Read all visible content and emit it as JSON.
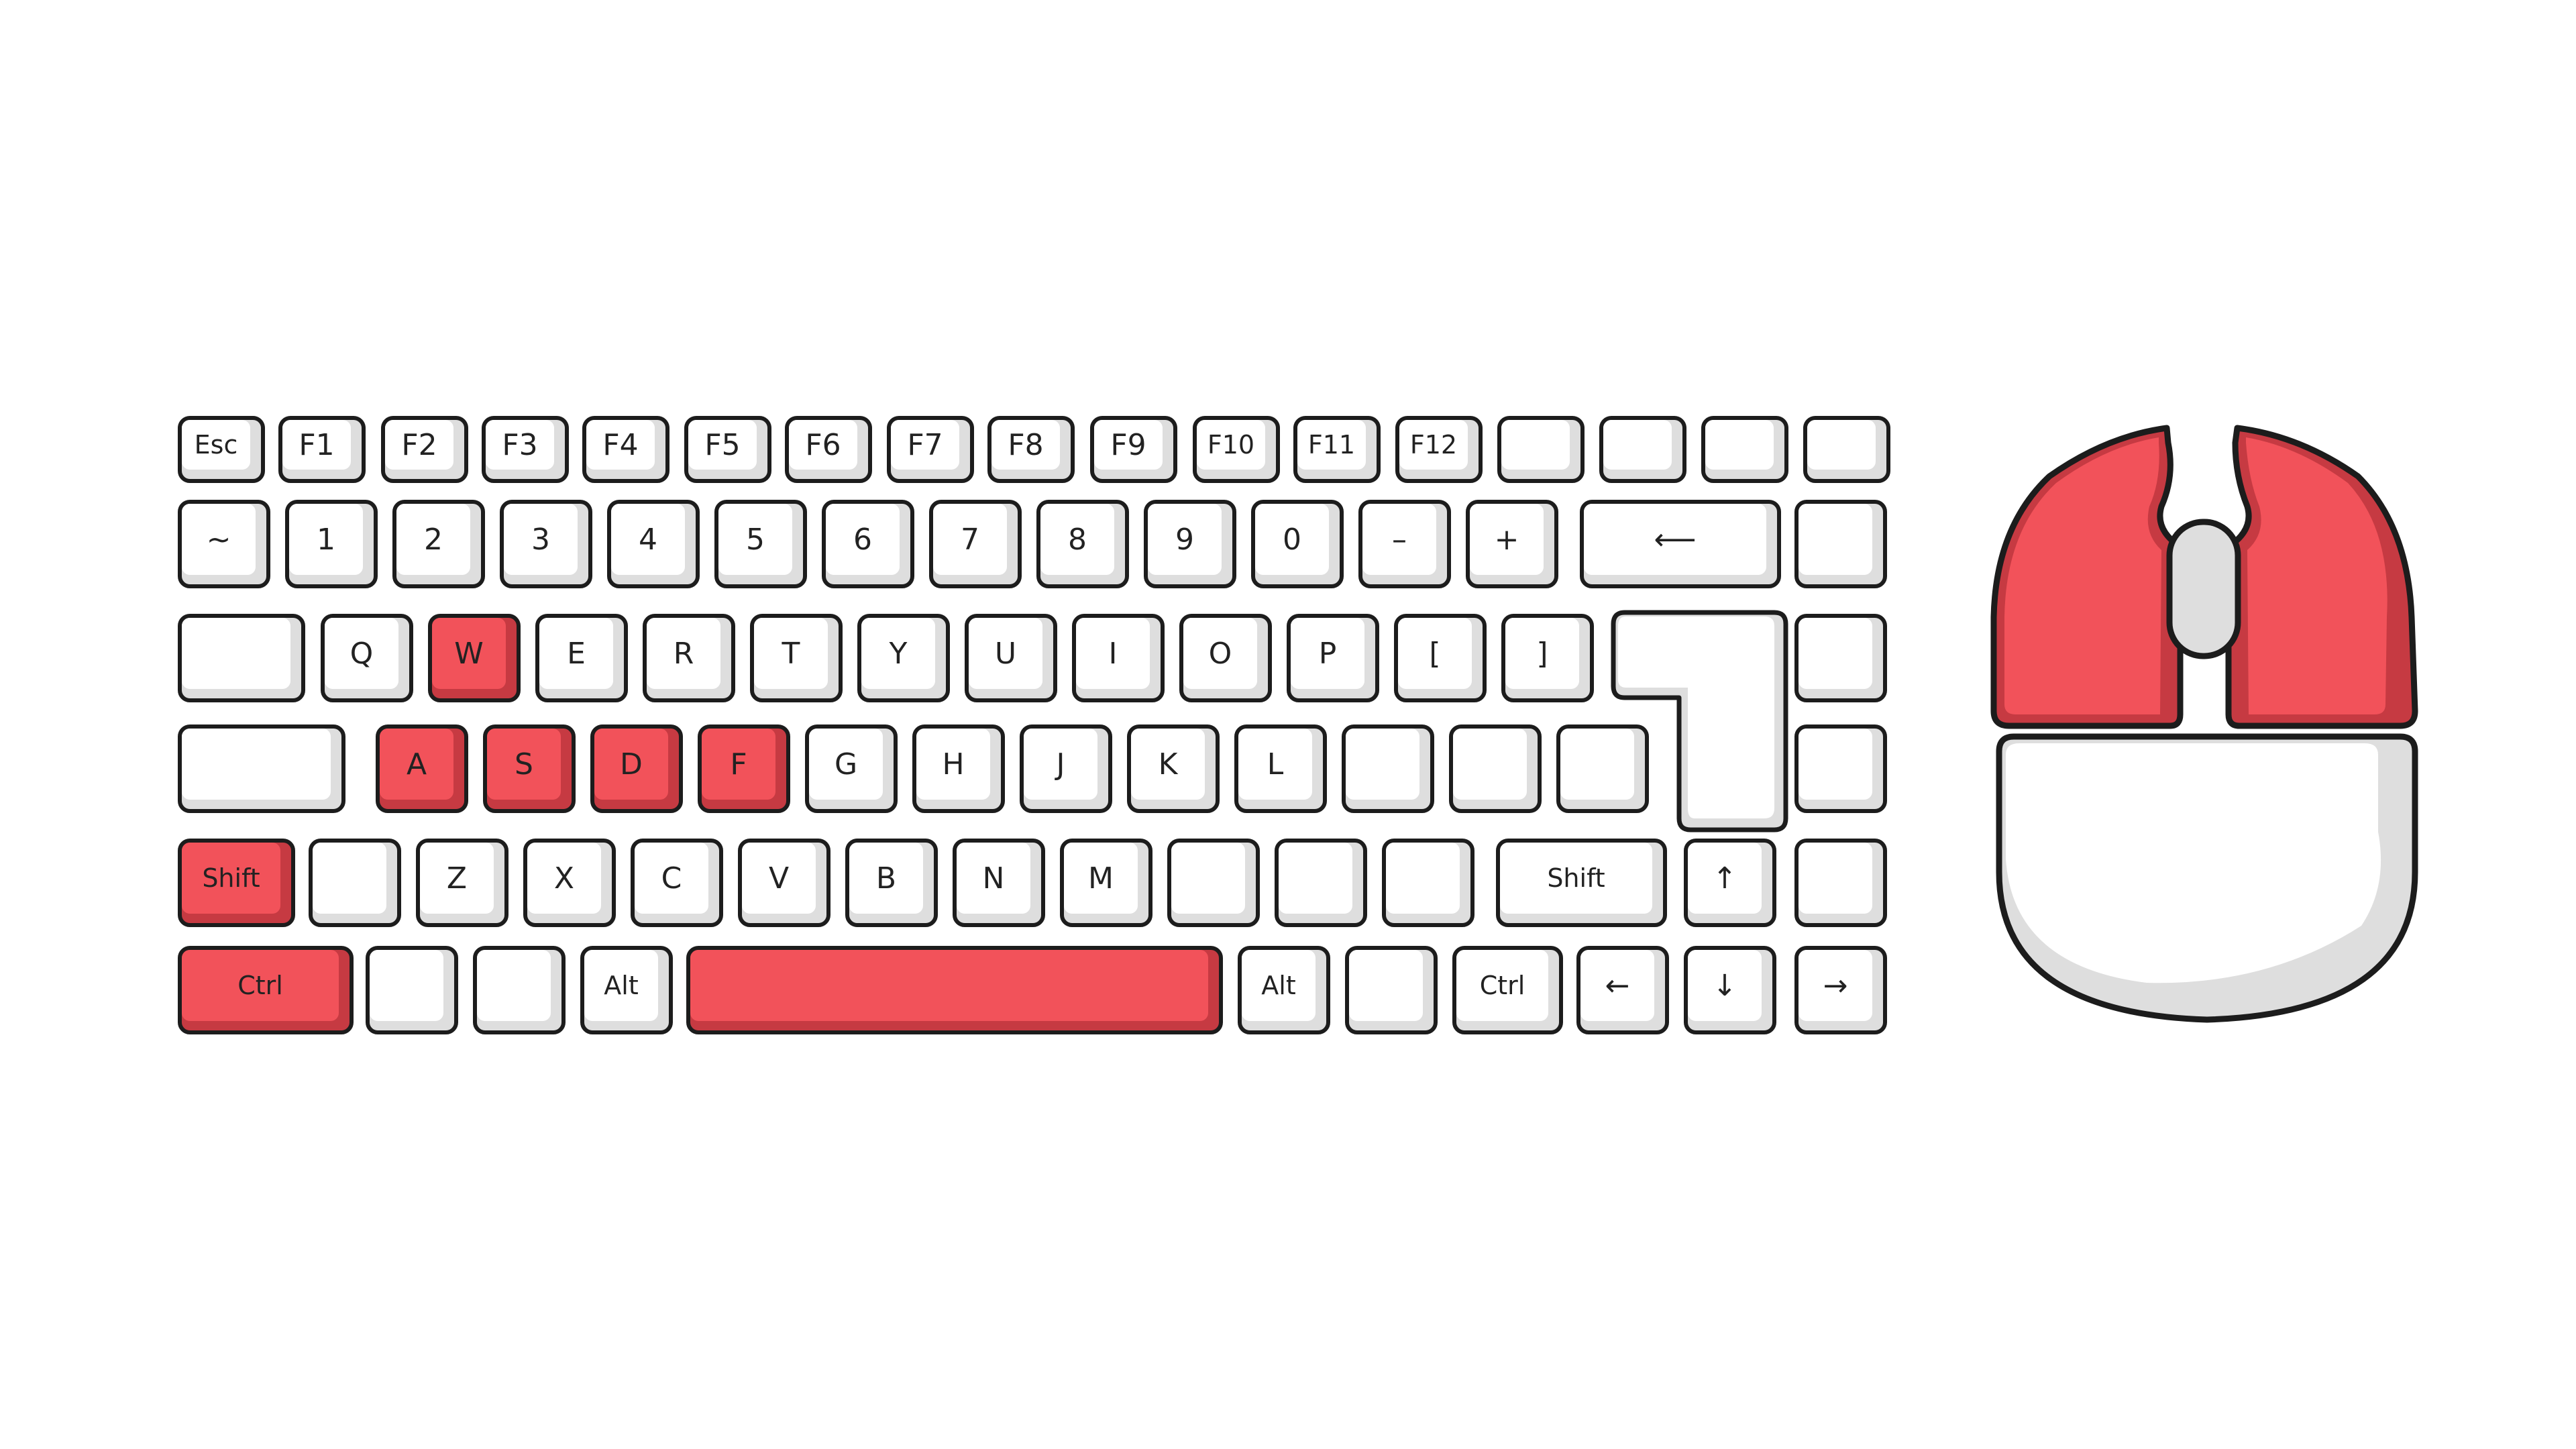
{
  "keyboard": {
    "highlight_color": "#f2525a",
    "rows": [
      [
        {
          "id": "esc",
          "label": "Esc"
        },
        {
          "id": "f1",
          "label": "F1"
        },
        {
          "id": "f2",
          "label": "F2"
        },
        {
          "id": "f3",
          "label": "F3"
        },
        {
          "id": "f4",
          "label": "F4"
        },
        {
          "id": "f5",
          "label": "F5"
        },
        {
          "id": "f6",
          "label": "F6"
        },
        {
          "id": "f7",
          "label": "F7"
        },
        {
          "id": "f8",
          "label": "F8"
        },
        {
          "id": "f9",
          "label": "F9"
        },
        {
          "id": "f10",
          "label": "F10"
        },
        {
          "id": "f11",
          "label": "F11"
        },
        {
          "id": "f12",
          "label": "F12"
        },
        {
          "id": "blank",
          "label": ""
        },
        {
          "id": "blank",
          "label": ""
        },
        {
          "id": "blank",
          "label": ""
        },
        {
          "id": "blank",
          "label": ""
        }
      ],
      [
        {
          "id": "tilde",
          "label": "~"
        },
        {
          "id": "1",
          "label": "1"
        },
        {
          "id": "2",
          "label": "2"
        },
        {
          "id": "3",
          "label": "3"
        },
        {
          "id": "4",
          "label": "4"
        },
        {
          "id": "5",
          "label": "5"
        },
        {
          "id": "6",
          "label": "6"
        },
        {
          "id": "7",
          "label": "7"
        },
        {
          "id": "8",
          "label": "8"
        },
        {
          "id": "9",
          "label": "9"
        },
        {
          "id": "0",
          "label": "0"
        },
        {
          "id": "minus",
          "label": "–"
        },
        {
          "id": "plus",
          "label": "+"
        },
        {
          "id": "backspace",
          "label": "⟵"
        },
        {
          "id": "blank",
          "label": ""
        }
      ],
      [
        {
          "id": "tab",
          "label": ""
        },
        {
          "id": "q",
          "label": "Q"
        },
        {
          "id": "w",
          "label": "W",
          "highlighted": true
        },
        {
          "id": "e",
          "label": "E"
        },
        {
          "id": "r",
          "label": "R"
        },
        {
          "id": "t",
          "label": "T"
        },
        {
          "id": "y",
          "label": "Y"
        },
        {
          "id": "u",
          "label": "U"
        },
        {
          "id": "i",
          "label": "I"
        },
        {
          "id": "o",
          "label": "O"
        },
        {
          "id": "p",
          "label": "P"
        },
        {
          "id": "lbracket",
          "label": "["
        },
        {
          "id": "rbracket",
          "label": "]"
        },
        {
          "id": "blank",
          "label": ""
        }
      ],
      [
        {
          "id": "caps",
          "label": ""
        },
        {
          "id": "a",
          "label": "A",
          "highlighted": true
        },
        {
          "id": "s",
          "label": "S",
          "highlighted": true
        },
        {
          "id": "d",
          "label": "D",
          "highlighted": true
        },
        {
          "id": "f",
          "label": "F",
          "highlighted": true
        },
        {
          "id": "g",
          "label": "G"
        },
        {
          "id": "h",
          "label": "H"
        },
        {
          "id": "j",
          "label": "J"
        },
        {
          "id": "k",
          "label": "K"
        },
        {
          "id": "l",
          "label": "L"
        },
        {
          "id": "blank",
          "label": ""
        },
        {
          "id": "blank",
          "label": ""
        },
        {
          "id": "blank",
          "label": ""
        },
        {
          "id": "blank",
          "label": ""
        }
      ],
      [
        {
          "id": "lshift",
          "label": "Shift",
          "highlighted": true
        },
        {
          "id": "blank",
          "label": ""
        },
        {
          "id": "z",
          "label": "Z"
        },
        {
          "id": "x",
          "label": "X"
        },
        {
          "id": "c",
          "label": "C"
        },
        {
          "id": "v",
          "label": "V"
        },
        {
          "id": "b",
          "label": "B"
        },
        {
          "id": "n",
          "label": "N"
        },
        {
          "id": "m",
          "label": "M"
        },
        {
          "id": "blank",
          "label": ""
        },
        {
          "id": "blank",
          "label": ""
        },
        {
          "id": "blank",
          "label": ""
        },
        {
          "id": "rshift",
          "label": "Shift"
        },
        {
          "id": "up",
          "label": "↑"
        },
        {
          "id": "blank",
          "label": ""
        }
      ],
      [
        {
          "id": "lctrl",
          "label": "Ctrl",
          "highlighted": true
        },
        {
          "id": "blank",
          "label": ""
        },
        {
          "id": "blank",
          "label": ""
        },
        {
          "id": "lalt",
          "label": "Alt"
        },
        {
          "id": "space",
          "label": "",
          "highlighted": true
        },
        {
          "id": "ralt",
          "label": "Alt"
        },
        {
          "id": "blank",
          "label": ""
        },
        {
          "id": "rctrl",
          "label": "Ctrl"
        },
        {
          "id": "left",
          "label": "←"
        },
        {
          "id": "down",
          "label": "↓"
        },
        {
          "id": "right",
          "label": "→"
        }
      ]
    ]
  },
  "mouse": {
    "left_button_highlighted": true,
    "right_button_highlighted": true,
    "scroll_wheel_highlighted": false,
    "body_highlighted": false
  }
}
